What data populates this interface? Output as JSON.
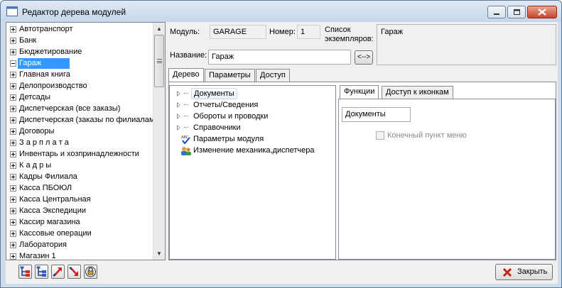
{
  "window": {
    "title": "Редактор дерева модулей"
  },
  "modules": [
    {
      "label": "Автотранспорт",
      "expanded": false
    },
    {
      "label": "Банк",
      "expanded": false
    },
    {
      "label": "Бюджетирование",
      "expanded": false
    },
    {
      "label": "Гараж",
      "expanded": true,
      "selected": true
    },
    {
      "label": "Главная книга",
      "expanded": false
    },
    {
      "label": "Делопроизводство",
      "expanded": false
    },
    {
      "label": "Детсады",
      "expanded": false
    },
    {
      "label": "Диспетчерская (все заказы)",
      "expanded": false
    },
    {
      "label": "Диспетчерская (заказы по филиалам",
      "expanded": false
    },
    {
      "label": "Договоры",
      "expanded": false
    },
    {
      "label": "З а р п л а т а",
      "expanded": false
    },
    {
      "label": "Инвентарь и хозпринадлежности",
      "expanded": false
    },
    {
      "label": "К а д р ы",
      "expanded": false
    },
    {
      "label": "Кадры Филиала",
      "expanded": false
    },
    {
      "label": "Касса ПБОЮЛ",
      "expanded": false
    },
    {
      "label": "Касса Центральная",
      "expanded": false
    },
    {
      "label": "Касса Экспедиции",
      "expanded": false
    },
    {
      "label": "Кассир магазина",
      "expanded": false
    },
    {
      "label": "Кассовые операции",
      "expanded": false
    },
    {
      "label": "Лаборатория",
      "expanded": false
    },
    {
      "label": "Магазин 1",
      "expanded": false
    }
  ],
  "header": {
    "module_label": "Модуль:",
    "module_value": "GARAGE",
    "number_label": "Номер:",
    "number_value": "1",
    "instances_label_1": "Список",
    "instances_label_2": "экземпляров:",
    "instances_value": "Гараж",
    "name_label": "Название:",
    "name_value": "Гараж",
    "swap_button": "<-->"
  },
  "tabs": [
    "Дерево",
    "Параметры",
    "Доступ"
  ],
  "tree_nodes": [
    {
      "label": "Документы",
      "kind": "folder",
      "highlighted": true
    },
    {
      "label": "Отчеты/Сведения",
      "kind": "folder"
    },
    {
      "label": "Обороты и проводки",
      "kind": "folder"
    },
    {
      "label": "Справочники",
      "kind": "folder"
    },
    {
      "label": "Параметры модуля",
      "kind": "abc-check-icon"
    },
    {
      "label": "Изменение механика,диспетчера",
      "kind": "users-icon"
    }
  ],
  "sub_tabs": [
    "Функции",
    "Доступ к иконкам"
  ],
  "function_value": "Документы",
  "endpoint_checkbox": {
    "label": "Конечный пункт меню",
    "checked": false,
    "enabled": false
  },
  "close_button": "Закрыть",
  "colors": {
    "selection": "#3399ff",
    "close_icon": "#c8231a",
    "title_gradient_top": "#dfe9f5"
  }
}
